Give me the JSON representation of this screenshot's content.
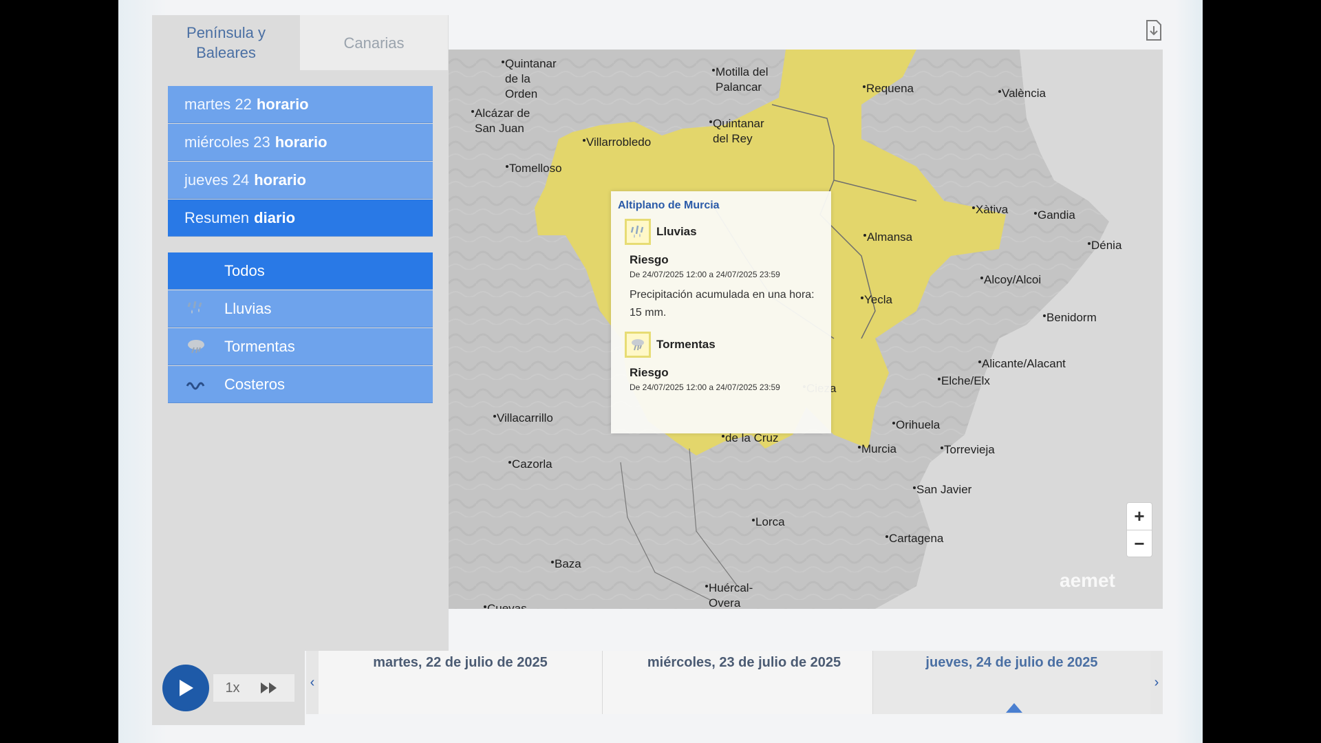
{
  "region_tabs": [
    {
      "label": "Península y Baleares"
    },
    {
      "label": "Canarias"
    }
  ],
  "day_menu": [
    {
      "day": "martes 22",
      "kind": "horario"
    },
    {
      "day": "miércoles 23",
      "kind": "horario"
    },
    {
      "day": "jueves 24",
      "kind": "horario"
    },
    {
      "day": "Resumen",
      "kind": "diario"
    }
  ],
  "filters": [
    {
      "label": "Todos",
      "icon": "all"
    },
    {
      "label": "Lluvias",
      "icon": "rain-icon"
    },
    {
      "label": "Tormentas",
      "icon": "storm-icon"
    },
    {
      "label": "Costeros",
      "icon": "coastal-icon"
    }
  ],
  "cities": [
    {
      "name": "Quintanar\nde la\nOrden"
    },
    {
      "name": "Alcázar de\nSan Juan"
    },
    {
      "name": "Motilla del\nPalancar"
    },
    {
      "name": "Requena"
    },
    {
      "name": "València"
    },
    {
      "name": "Quintanar\ndel Rey"
    },
    {
      "name": "Villarrobledo"
    },
    {
      "name": "Tomelloso"
    },
    {
      "name": "Xàtiva"
    },
    {
      "name": "Gandia"
    },
    {
      "name": "Dénia"
    },
    {
      "name": "Almansa"
    },
    {
      "name": "Alcoy/Alcoi"
    },
    {
      "name": "Yecla"
    },
    {
      "name": "Benidorm"
    },
    {
      "name": "Alicante/Alacant"
    },
    {
      "name": "Elche/Elx"
    },
    {
      "name": "Villacarrillo"
    },
    {
      "name": "Orihuela"
    },
    {
      "name": "Torrevieja"
    },
    {
      "name": "Murcia"
    },
    {
      "name": "Cazorla"
    },
    {
      "name": "San Javier"
    },
    {
      "name": "Lorca"
    },
    {
      "name": "Cartagena"
    },
    {
      "name": "Baza"
    },
    {
      "name": "Huércal-\nOvera"
    },
    {
      "name": "Cuevas"
    },
    {
      "name": "de la Cruz"
    },
    {
      "name": "Cieza"
    }
  ],
  "popup": {
    "title": "Altiplano de Murcia",
    "risks": [
      {
        "name": "Lluvias",
        "level": "Riesgo",
        "dates": "De 24/07/2025 12:00 a 24/07/2025 23:59",
        "description": "Precipitación acumulada en una hora: 15 mm."
      },
      {
        "name": "Tormentas",
        "level": "Riesgo",
        "dates": "De 24/07/2025 12:00 a 24/07/2025 23:59"
      }
    ]
  },
  "zoom": {
    "in": "+",
    "out": "−"
  },
  "logo": "aemet",
  "playback": {
    "speed": "1x"
  },
  "timeline": {
    "prev": "‹",
    "next": "›",
    "days": [
      {
        "label": "martes, 22 de julio de 2025"
      },
      {
        "label": "miércoles, 23 de julio de 2025"
      },
      {
        "label": "jueves, 24 de julio de 2025"
      }
    ]
  },
  "colors": {
    "warning_yellow": "#e8d86a",
    "menu_blue": "#6ea3ec",
    "menu_selected": "#2979e6",
    "play_blue": "#1e5aa8",
    "map_grey": "#c3c3c3"
  }
}
